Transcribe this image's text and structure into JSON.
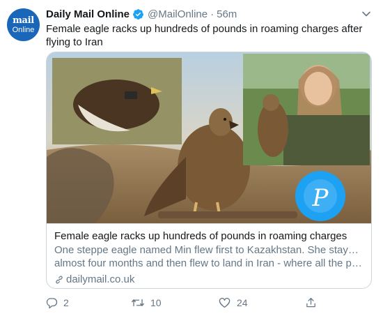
{
  "tweet": {
    "avatar": {
      "line1": "mail",
      "line2": "Online"
    },
    "display_name": "Daily Mail Online",
    "handle": "@MailOnline",
    "separator": "·",
    "time": "56m",
    "text": "Female eagle racks up hundreds of pounds in roaming charges after flying to Iran"
  },
  "card": {
    "title": "Female eagle racks up hundreds of pounds in roaming charges",
    "description_line1": "One steppe eagle named Min flew first to Kazakhstan. She stayed there",
    "description_line2": "almost four months and then flew to land in Iran - where all the previou...",
    "domain": "dailymail.co.uk"
  },
  "actions": {
    "reply_count": "2",
    "retweet_count": "10",
    "like_count": "24"
  },
  "colors": {
    "brand_blue": "#1da1f2",
    "avatar_blue": "#1a66b8",
    "secondary_text": "#657786",
    "border": "#ccd6dd"
  },
  "icons": [
    "verified-badge-icon",
    "chevron-down-icon",
    "reply-icon",
    "retweet-icon",
    "like-icon",
    "share-icon",
    "link-icon"
  ]
}
